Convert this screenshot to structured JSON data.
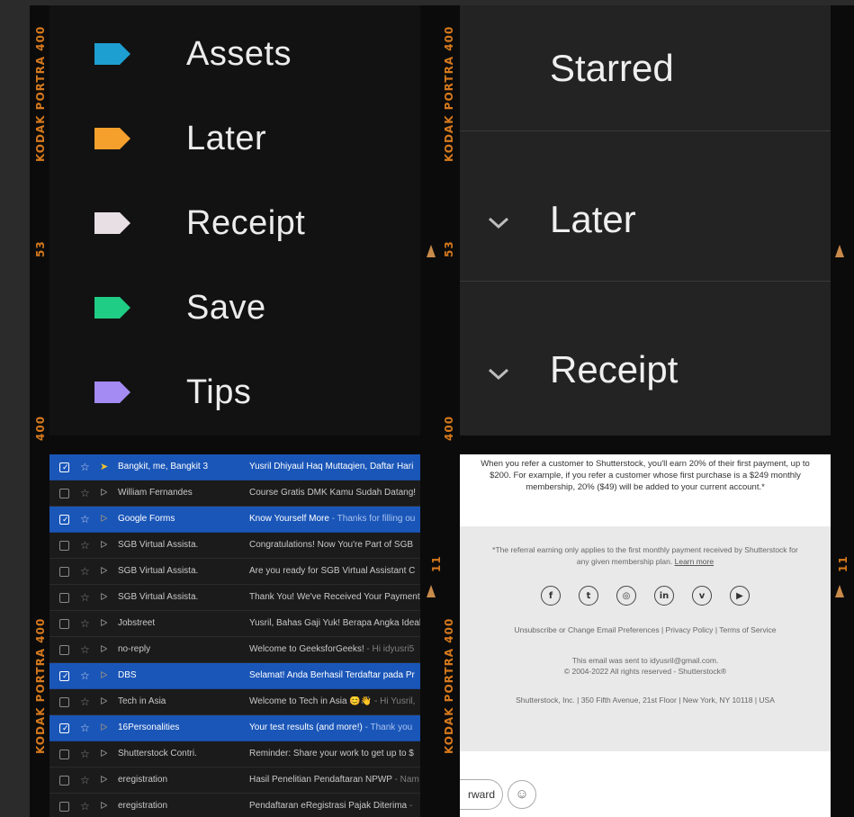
{
  "film_edge": {
    "brand_top": "KODAK  PORTRA 400",
    "brand_bottom": "KODAK  PORTRA 400",
    "brand_top_right": "KODAK  PORTRA 400",
    "brand_bottom_right": "KODAK  PORTRA 400",
    "frame_no_left_top": "53",
    "frame_no_right_top": "53",
    "frame_no_left_bottom": "11",
    "frame_no_right_bottom": "11",
    "num_400_left": "400",
    "num_400_right": "400",
    "color": "#d6791d"
  },
  "labels_panel": {
    "items": [
      {
        "label": "Assets",
        "color": "#1e9fd1"
      },
      {
        "label": "Later",
        "color": "#f5a02d"
      },
      {
        "label": "Receipt",
        "color": "#e8dfe5"
      },
      {
        "label": "Save",
        "color": "#1fcd84"
      },
      {
        "label": "Tips",
        "color": "#a48bf3"
      }
    ]
  },
  "sections_panel": {
    "items": [
      {
        "label": "Starred",
        "chevron": false
      },
      {
        "label": "Later",
        "chevron": true
      },
      {
        "label": "Receipt",
        "chevron": true
      }
    ]
  },
  "email_list": {
    "rows": [
      {
        "selected": true,
        "important": true,
        "sender": "Bangkit, me, Bangkit 3",
        "subject": "Yusril Dhiyaul Haq Muttaqien, Daftar Hari",
        "snippet": ""
      },
      {
        "selected": false,
        "important": false,
        "sender": "William Fernandes",
        "subject": "Course Gratis DMK Kamu Sudah Datang!",
        "snippet": ""
      },
      {
        "selected": true,
        "important": false,
        "sender": "Google Forms",
        "subject": "Know Yourself More",
        "snippet": " - Thanks for filling ou"
      },
      {
        "selected": false,
        "important": false,
        "sender": "SGB Virtual Assista.",
        "subject": "Congratulations! Now You're Part of SGB",
        "snippet": ""
      },
      {
        "selected": false,
        "important": false,
        "sender": "SGB Virtual Assista.",
        "subject": "Are you ready for SGB Virtual Assistant C",
        "snippet": ""
      },
      {
        "selected": false,
        "important": false,
        "sender": "SGB Virtual Assista.",
        "subject": "Thank You! We've Received Your Payment",
        "snippet": ""
      },
      {
        "selected": false,
        "important": false,
        "sender": "Jobstreet",
        "subject": "Yusril, Bahas Gaji Yuk! Berapa Angka Ideal",
        "snippet": ""
      },
      {
        "selected": false,
        "important": false,
        "sender": "no-reply",
        "subject": "Welcome to GeeksforGeeks!",
        "snippet": " - Hi idyusri5"
      },
      {
        "selected": true,
        "important": false,
        "sender": "DBS",
        "subject": "Selamat! Anda Berhasil Terdaftar pada Pr",
        "snippet": ""
      },
      {
        "selected": false,
        "important": false,
        "sender": "Tech in Asia",
        "subject": "Welcome to Tech in Asia 😊👋",
        "snippet": " - Hi Yusril,"
      },
      {
        "selected": true,
        "important": false,
        "sender": "16Personalities",
        "subject": "Your test results (and more!)",
        "snippet": " - Thank you"
      },
      {
        "selected": false,
        "important": false,
        "sender": "Shutterstock Contri.",
        "subject": "Reminder: Share your work to get up to $",
        "snippet": ""
      },
      {
        "selected": false,
        "important": false,
        "sender": "eregistration",
        "subject": "Hasil Penelitian Pendaftaran NPWP",
        "snippet": " - Nam"
      },
      {
        "selected": false,
        "important": false,
        "sender": "eregistration",
        "subject": "Pendaftaran eRegistrasi Pajak Diterima",
        "snippet": " -"
      }
    ]
  },
  "email_footer": {
    "referral_text": "When you refer a customer to Shutterstock, you'll earn 20% of their first payment, up to $200. For example, if you refer a customer whose first purchase is a $249 monthly membership, 20% ($49) will be added to your current account.*",
    "note_text": "*The referral earning only applies to the first monthly payment received by Shutterstock for any given membership plan.",
    "learn_more": "Learn more",
    "social_icons": [
      "facebook-icon",
      "twitter-icon",
      "instagram-icon",
      "linkedin-icon",
      "vimeo-icon",
      "youtube-icon"
    ],
    "social_glyphs": [
      "f",
      "t",
      "◎",
      "in",
      "v",
      "▶"
    ],
    "links": [
      "Unsubscribe or Change Email Preferences",
      "Privacy Policy",
      "Terms of Service"
    ],
    "sent_to": "This email was sent to idyusril@gmail.com.",
    "copyright": "© 2004-2022 All rights reserved - Shutterstock®",
    "address": "Shutterstock, Inc. | 350 Fifth Avenue, 21st Floor | New York, NY 10118 | USA",
    "forward_label": "rward",
    "emoji_glyph": "☺"
  }
}
